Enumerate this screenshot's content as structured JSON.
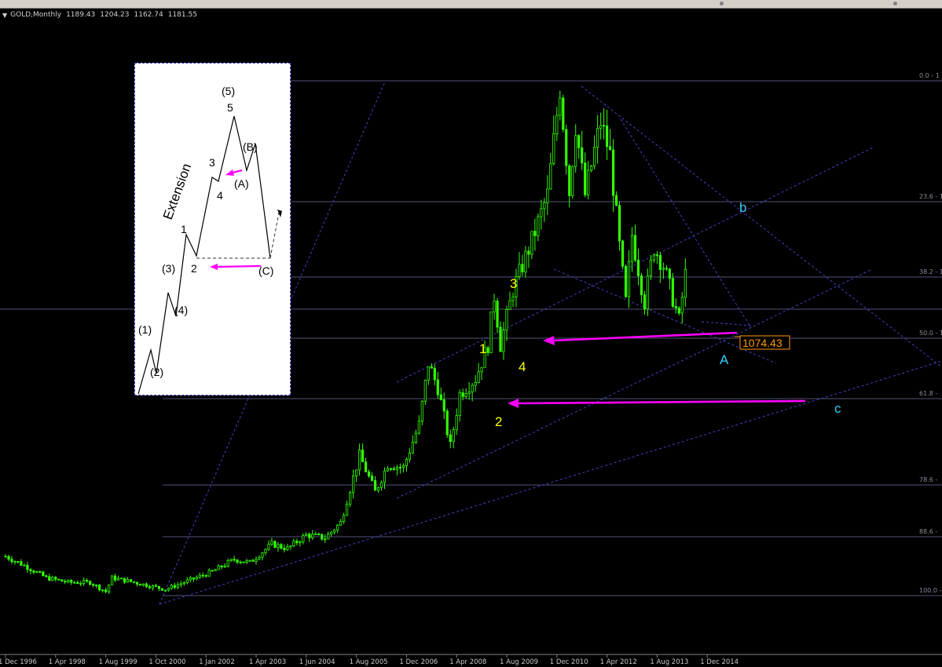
{
  "header": {
    "symbol": "GOLD,Monthly",
    "open": "1189.43",
    "high": "1204.23",
    "low": "1162.74",
    "close": "1181.55"
  },
  "colors": {
    "background": "#000000",
    "candle": "#33ff00",
    "fib_line": "#6e6ea0",
    "trend_line": "#4a4adc",
    "arrow": "#ff00ff",
    "wave_yellow": "#ffff00",
    "wave_cyan": "#33ccff",
    "price_tag_border": "#ff9900"
  },
  "chart_data": {
    "type": "candlestick",
    "title": "GOLD,Monthly",
    "timeframe": "Monthly",
    "ohlc_last": {
      "open": 1189.43,
      "high": 1204.23,
      "low": 1162.74,
      "close": 1181.55
    },
    "x_tick_labels": [
      "1 Dec 1996",
      "1 Apr 1998",
      "1 Aug 1999",
      "1 Oct 2000",
      "1 Jan 2002",
      "1 Apr 2003",
      "1 Jun 2004",
      "1 Aug 2005",
      "1 Dec 2006",
      "1 Apr 2008",
      "1 Aug 2009",
      "1 Dec 2010",
      "1 Apr 2012",
      "1 Aug 2013",
      "1 Dec 2014"
    ],
    "price_path": [
      [
        "1996-12",
        370
      ],
      [
        "1997-06",
        340
      ],
      [
        "1998-01",
        300
      ],
      [
        "1998-08",
        285
      ],
      [
        "1999-03",
        285
      ],
      [
        "1999-08",
        255
      ],
      [
        "1999-10",
        300
      ],
      [
        "2000-06",
        283
      ],
      [
        "2001-03",
        262
      ],
      [
        "2001-09",
        285
      ],
      [
        "2002-06",
        320
      ],
      [
        "2003-01",
        360
      ],
      [
        "2003-06",
        350
      ],
      [
        "2004-01",
        410
      ],
      [
        "2004-06",
        395
      ],
      [
        "2004-12",
        440
      ],
      [
        "2005-06",
        430
      ],
      [
        "2005-11",
        480
      ],
      [
        "2006-05",
        700
      ],
      [
        "2006-10",
        580
      ],
      [
        "2007-02",
        670
      ],
      [
        "2007-07",
        660
      ],
      [
        "2007-12",
        800
      ],
      [
        "2008-03",
        1000
      ],
      [
        "2008-06",
        920
      ],
      [
        "2008-10",
        730
      ],
      [
        "2009-01",
        900
      ],
      [
        "2009-06",
        950
      ],
      [
        "2009-10",
        1060
      ],
      [
        "2009-12",
        1220
      ],
      [
        "2010-02",
        1060
      ],
      [
        "2010-06",
        1240
      ],
      [
        "2010-12",
        1400
      ],
      [
        "2011-05",
        1550
      ],
      [
        "2011-09",
        1900
      ],
      [
        "2011-12",
        1560
      ],
      [
        "2012-02",
        1780
      ],
      [
        "2012-05",
        1550
      ],
      [
        "2012-10",
        1790
      ],
      [
        "2013-01",
        1680
      ],
      [
        "2013-04",
        1380
      ],
      [
        "2013-06",
        1200
      ],
      [
        "2013-08",
        1420
      ],
      [
        "2013-12",
        1200
      ],
      [
        "2014-03",
        1380
      ],
      [
        "2014-06",
        1320
      ],
      [
        "2014-11",
        1140
      ],
      [
        "2015-01",
        1290
      ],
      [
        "2015-02",
        1181.55
      ]
    ],
    "fibonacci_levels": [
      "0.0 - 1",
      "23.6 - 1",
      "38.2 - 1",
      "50.0 - 1",
      "61.8 -",
      "78.6 -",
      "88.6 -",
      "100.0 -"
    ],
    "price_tag": "1074.43",
    "wave_labels_main": [
      "1",
      "2",
      "3",
      "4"
    ],
    "wave_labels_correction": [
      "A",
      "b",
      "c"
    ],
    "grid": false
  },
  "inset": {
    "title": "Extension",
    "labels": {
      "w1": "(1)",
      "w2": "(2)",
      "w3": "(3)",
      "w4": "(4)",
      "n1": "1",
      "n2": "2",
      "n3": "3",
      "n4": "4",
      "n5": "5",
      "w5": "(5)",
      "wa": "(A)",
      "wb": "(B)",
      "wc": "(C)"
    }
  }
}
